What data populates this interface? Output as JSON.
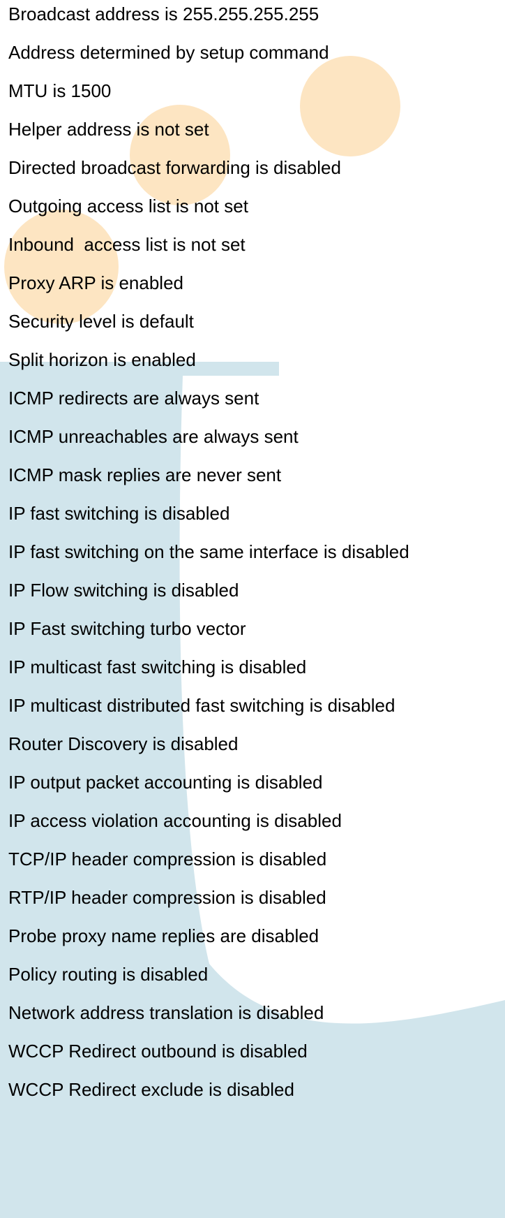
{
  "colors": {
    "text": "#000000",
    "background": "#ffffff",
    "watermark_blue": "#c9e0e9",
    "accent_orange": "#fde5c2"
  },
  "lines": [
    "Broadcast address is 255.255.255.255",
    "Address determined by setup command",
    "MTU is 1500",
    "Helper address is not set",
    "Directed broadcast forwarding is disabled",
    "Outgoing access list is not set",
    "Inbound  access list is not set",
    "Proxy ARP is enabled",
    "Security level is default",
    "Split horizon is enabled",
    "ICMP redirects are always sent",
    "ICMP unreachables are always sent",
    "ICMP mask replies are never sent",
    "IP fast switching is disabled",
    "IP fast switching on the same interface is disabled",
    "IP Flow switching is disabled",
    "IP Fast switching turbo vector",
    "IP multicast fast switching is disabled",
    "IP multicast distributed fast switching is disabled",
    "Router Discovery is disabled",
    "IP output packet accounting is disabled",
    "IP access violation accounting is disabled",
    "TCP/IP header compression is disabled",
    "RTP/IP header compression is disabled",
    "Probe proxy name replies are disabled",
    "Policy routing is disabled",
    "Network address translation is disabled",
    "WCCP Redirect outbound is disabled",
    "WCCP Redirect exclude is disabled"
  ]
}
